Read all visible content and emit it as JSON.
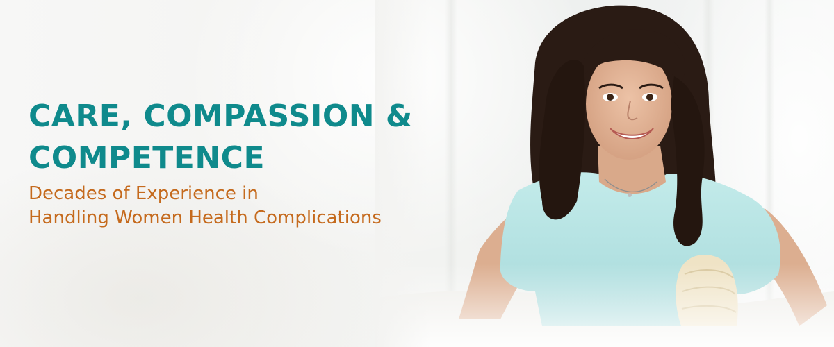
{
  "banner": {
    "headline_line1": "CARE, COMPASSION &",
    "headline_line2": "COMPETENCE",
    "subline_line1": "Decades of Experience in",
    "subline_line2": "Handling Women Health Complications"
  },
  "colors": {
    "headline": "#0f8a8c",
    "subline": "#c56a1d",
    "shirt": "#b7e3e3",
    "hair": "#2a1b14",
    "skin": "#e2b397"
  },
  "image": {
    "subject": "smiling-woman-photo"
  }
}
